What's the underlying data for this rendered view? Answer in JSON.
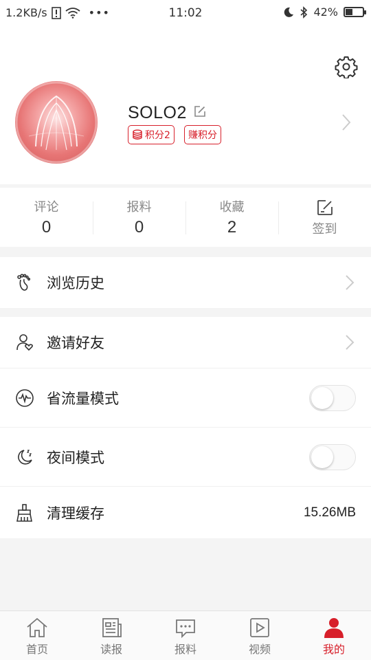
{
  "status_bar": {
    "net_speed": "1.2KB/s",
    "time": "11:02",
    "battery": "42%",
    "battery_level": 0.42
  },
  "profile": {
    "username": "SOLO2",
    "points_badge": "积分2",
    "earn_badge": "赚积分"
  },
  "stats": [
    {
      "label": "评论",
      "value": "0"
    },
    {
      "label": "报料",
      "value": "0"
    },
    {
      "label": "收藏",
      "value": "2"
    }
  ],
  "checkin": {
    "label": "签到"
  },
  "menu": {
    "history": "浏览历史",
    "invite": "邀请好友",
    "data_saver": "省流量模式",
    "data_saver_on": false,
    "night_mode": "夜间模式",
    "night_mode_on": false,
    "clear_cache": "清理缓存",
    "cache_size": "15.26MB"
  },
  "tabs": [
    {
      "label": "首页",
      "icon": "home-icon"
    },
    {
      "label": "读报",
      "icon": "newspaper-icon"
    },
    {
      "label": "报料",
      "icon": "chat-bubble-icon"
    },
    {
      "label": "视频",
      "icon": "video-icon"
    },
    {
      "label": "我的",
      "icon": "person-icon",
      "active": true
    }
  ],
  "colors": {
    "accent": "#d71f2a"
  }
}
